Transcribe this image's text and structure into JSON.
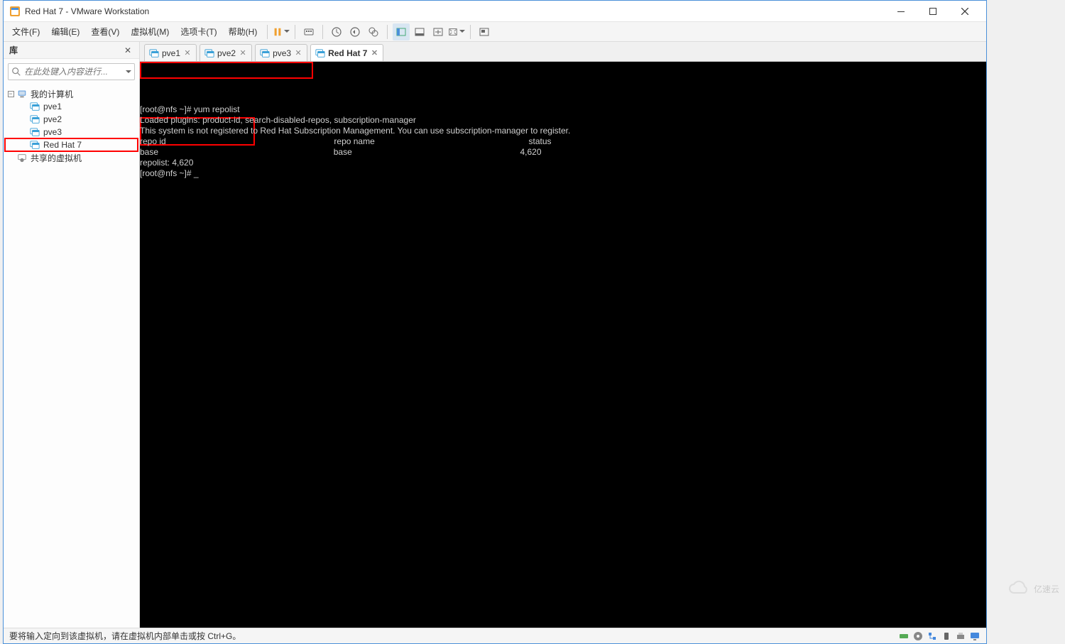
{
  "window": {
    "title": "Red Hat 7 - VMware Workstation"
  },
  "menu": {
    "file": "文件(F)",
    "edit": "编辑(E)",
    "view": "查看(V)",
    "vm": "虚拟机(M)",
    "tabs": "选项卡(T)",
    "help": "帮助(H)"
  },
  "sidebar": {
    "title": "库",
    "search_placeholder": "在此处键入内容进行...",
    "root_label": "我的计算机",
    "items": [
      {
        "label": "pve1"
      },
      {
        "label": "pve2"
      },
      {
        "label": "pve3"
      },
      {
        "label": "Red Hat 7",
        "selected": true
      }
    ],
    "shared_label": "共享的虚拟机"
  },
  "tabs": [
    {
      "label": "pve1",
      "active": false
    },
    {
      "label": "pve2",
      "active": false
    },
    {
      "label": "pve3",
      "active": false
    },
    {
      "label": "Red Hat 7",
      "active": true
    }
  ],
  "terminal": {
    "line1": "[root@nfs ~]# yum repolist",
    "line2": "Loaded plugins: product-id, search-disabled-repos, subscription-manager",
    "line3": "This system is not registered to Red Hat Subscription Management. You can use subscription-manager to register.",
    "line4_c1": "repo id",
    "line4_c2": "repo name",
    "line4_c3": "status",
    "line5_c1": "base",
    "line5_c2": "base",
    "line5_c3": "4,620",
    "line6": "repolist: 4,620",
    "line7": "[root@nfs ~]# "
  },
  "statusbar": {
    "text": "要将输入定向到该虚拟机，请在虚拟机内部单击或按 Ctrl+G。"
  },
  "watermark": {
    "text": "亿速云"
  }
}
